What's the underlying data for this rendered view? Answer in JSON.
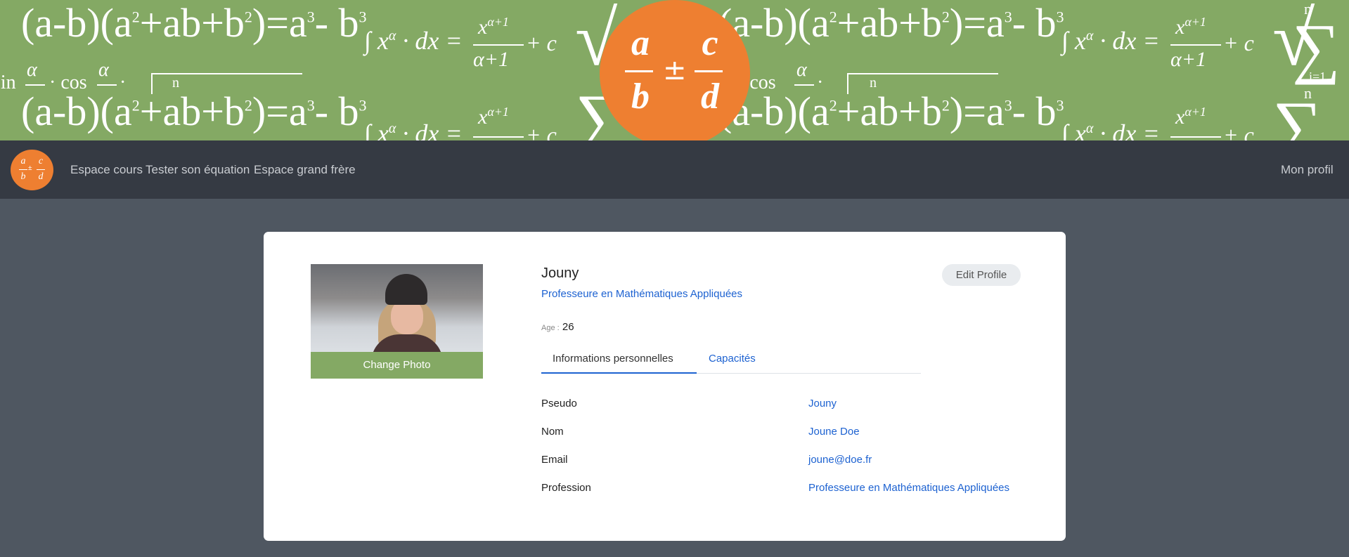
{
  "banner": {
    "formula_cubes": "(a-b)(a²+ab+b²)=a³-b³",
    "formula_integral": "∫xᵅ · dx = xᵅ⁺¹⁄(α+1) + c",
    "formula_trig": "sin α · cos α ·",
    "sum_upper": "n",
    "sum_lower": "i=1",
    "logo_a": "a",
    "logo_b": "b",
    "logo_c": "c",
    "logo_d": "d",
    "logo_pm": "±"
  },
  "navbar": {
    "logo_a": "a",
    "logo_b": "b",
    "logo_c": "c",
    "logo_d": "d",
    "logo_pm": "±",
    "links": [
      "Espace cours",
      "Tester son équation",
      "Espace grand frère"
    ],
    "profile": "Mon profil"
  },
  "profile": {
    "change_photo": "Change Photo",
    "name": "Jouny",
    "profession": "Professeure en Mathématiques Appliquées",
    "age_label": "Age :",
    "age_value": "26",
    "edit_button": "Edit Profile",
    "tabs": [
      "Informations personnelles",
      "Capacités"
    ],
    "fields": [
      {
        "label": "Pseudo",
        "value": "Jouny"
      },
      {
        "label": "Nom",
        "value": "Joune Doe"
      },
      {
        "label": "Email",
        "value": "joune@doe.fr"
      },
      {
        "label": "Profession",
        "value": "Professeure en Mathématiques Appliquées"
      }
    ]
  },
  "colors": {
    "banner_green": "#84a964",
    "logo_orange": "#ee7f31",
    "navbar": "#353a43",
    "page_bg": "#4f5761",
    "link_blue": "#1d62d1"
  }
}
